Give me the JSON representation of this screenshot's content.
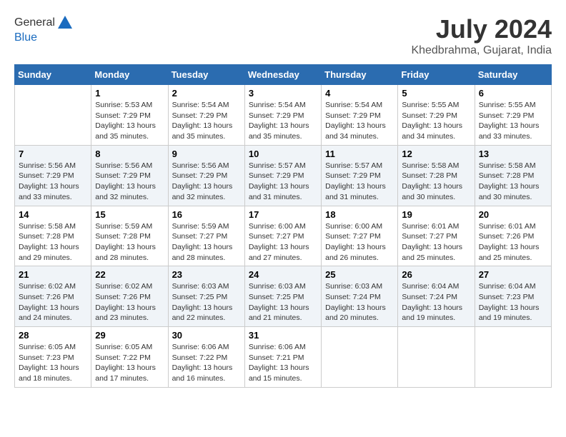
{
  "header": {
    "logo_line1": "General",
    "logo_line2": "Blue",
    "month_year": "July 2024",
    "location": "Khedbrahma, Gujarat, India"
  },
  "weekdays": [
    "Sunday",
    "Monday",
    "Tuesday",
    "Wednesday",
    "Thursday",
    "Friday",
    "Saturday"
  ],
  "weeks": [
    [
      {
        "day": "",
        "info": ""
      },
      {
        "day": "1",
        "info": "Sunrise: 5:53 AM\nSunset: 7:29 PM\nDaylight: 13 hours\nand 35 minutes."
      },
      {
        "day": "2",
        "info": "Sunrise: 5:54 AM\nSunset: 7:29 PM\nDaylight: 13 hours\nand 35 minutes."
      },
      {
        "day": "3",
        "info": "Sunrise: 5:54 AM\nSunset: 7:29 PM\nDaylight: 13 hours\nand 35 minutes."
      },
      {
        "day": "4",
        "info": "Sunrise: 5:54 AM\nSunset: 7:29 PM\nDaylight: 13 hours\nand 34 minutes."
      },
      {
        "day": "5",
        "info": "Sunrise: 5:55 AM\nSunset: 7:29 PM\nDaylight: 13 hours\nand 34 minutes."
      },
      {
        "day": "6",
        "info": "Sunrise: 5:55 AM\nSunset: 7:29 PM\nDaylight: 13 hours\nand 33 minutes."
      }
    ],
    [
      {
        "day": "7",
        "info": "Sunrise: 5:56 AM\nSunset: 7:29 PM\nDaylight: 13 hours\nand 33 minutes."
      },
      {
        "day": "8",
        "info": "Sunrise: 5:56 AM\nSunset: 7:29 PM\nDaylight: 13 hours\nand 32 minutes."
      },
      {
        "day": "9",
        "info": "Sunrise: 5:56 AM\nSunset: 7:29 PM\nDaylight: 13 hours\nand 32 minutes."
      },
      {
        "day": "10",
        "info": "Sunrise: 5:57 AM\nSunset: 7:29 PM\nDaylight: 13 hours\nand 31 minutes."
      },
      {
        "day": "11",
        "info": "Sunrise: 5:57 AM\nSunset: 7:29 PM\nDaylight: 13 hours\nand 31 minutes."
      },
      {
        "day": "12",
        "info": "Sunrise: 5:58 AM\nSunset: 7:28 PM\nDaylight: 13 hours\nand 30 minutes."
      },
      {
        "day": "13",
        "info": "Sunrise: 5:58 AM\nSunset: 7:28 PM\nDaylight: 13 hours\nand 30 minutes."
      }
    ],
    [
      {
        "day": "14",
        "info": "Sunrise: 5:58 AM\nSunset: 7:28 PM\nDaylight: 13 hours\nand 29 minutes."
      },
      {
        "day": "15",
        "info": "Sunrise: 5:59 AM\nSunset: 7:28 PM\nDaylight: 13 hours\nand 28 minutes."
      },
      {
        "day": "16",
        "info": "Sunrise: 5:59 AM\nSunset: 7:27 PM\nDaylight: 13 hours\nand 28 minutes."
      },
      {
        "day": "17",
        "info": "Sunrise: 6:00 AM\nSunset: 7:27 PM\nDaylight: 13 hours\nand 27 minutes."
      },
      {
        "day": "18",
        "info": "Sunrise: 6:00 AM\nSunset: 7:27 PM\nDaylight: 13 hours\nand 26 minutes."
      },
      {
        "day": "19",
        "info": "Sunrise: 6:01 AM\nSunset: 7:27 PM\nDaylight: 13 hours\nand 25 minutes."
      },
      {
        "day": "20",
        "info": "Sunrise: 6:01 AM\nSunset: 7:26 PM\nDaylight: 13 hours\nand 25 minutes."
      }
    ],
    [
      {
        "day": "21",
        "info": "Sunrise: 6:02 AM\nSunset: 7:26 PM\nDaylight: 13 hours\nand 24 minutes."
      },
      {
        "day": "22",
        "info": "Sunrise: 6:02 AM\nSunset: 7:26 PM\nDaylight: 13 hours\nand 23 minutes."
      },
      {
        "day": "23",
        "info": "Sunrise: 6:03 AM\nSunset: 7:25 PM\nDaylight: 13 hours\nand 22 minutes."
      },
      {
        "day": "24",
        "info": "Sunrise: 6:03 AM\nSunset: 7:25 PM\nDaylight: 13 hours\nand 21 minutes."
      },
      {
        "day": "25",
        "info": "Sunrise: 6:03 AM\nSunset: 7:24 PM\nDaylight: 13 hours\nand 20 minutes."
      },
      {
        "day": "26",
        "info": "Sunrise: 6:04 AM\nSunset: 7:24 PM\nDaylight: 13 hours\nand 19 minutes."
      },
      {
        "day": "27",
        "info": "Sunrise: 6:04 AM\nSunset: 7:23 PM\nDaylight: 13 hours\nand 19 minutes."
      }
    ],
    [
      {
        "day": "28",
        "info": "Sunrise: 6:05 AM\nSunset: 7:23 PM\nDaylight: 13 hours\nand 18 minutes."
      },
      {
        "day": "29",
        "info": "Sunrise: 6:05 AM\nSunset: 7:22 PM\nDaylight: 13 hours\nand 17 minutes."
      },
      {
        "day": "30",
        "info": "Sunrise: 6:06 AM\nSunset: 7:22 PM\nDaylight: 13 hours\nand 16 minutes."
      },
      {
        "day": "31",
        "info": "Sunrise: 6:06 AM\nSunset: 7:21 PM\nDaylight: 13 hours\nand 15 minutes."
      },
      {
        "day": "",
        "info": ""
      },
      {
        "day": "",
        "info": ""
      },
      {
        "day": "",
        "info": ""
      }
    ]
  ]
}
